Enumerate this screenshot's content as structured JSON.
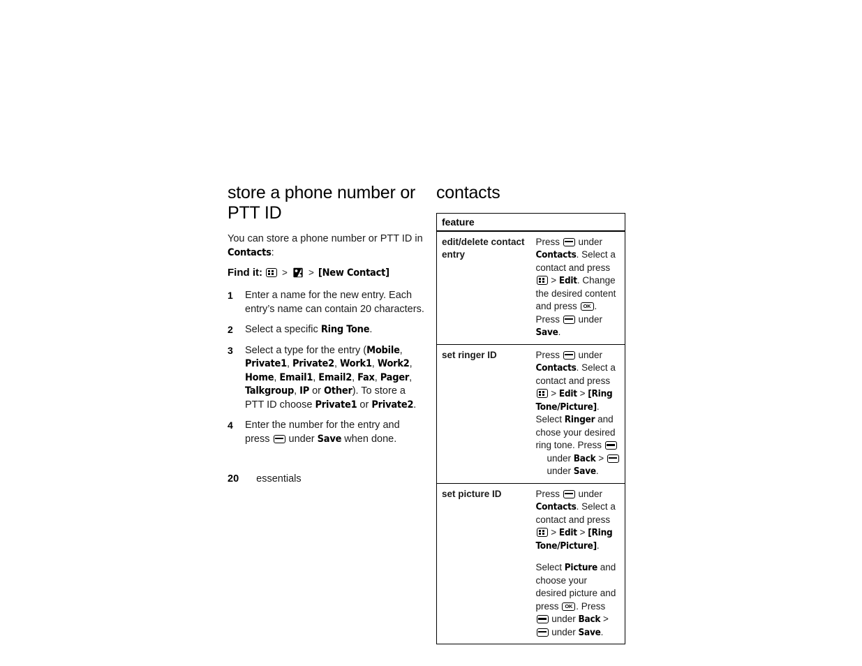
{
  "page": {
    "number": "20",
    "chapter": "essentials"
  },
  "left_column": {
    "heading": "store a phone number or PTT ID",
    "intro": {
      "text_before": "You can store a phone number or PTT ID in ",
      "ui_term": "Contacts",
      "text_after": ":"
    },
    "find_it": {
      "label": "Find it:",
      "icons": [
        "menu-key-icon",
        "contacts-book-icon"
      ],
      "separator": ">",
      "destination": "[New Contact]"
    },
    "steps": [
      {
        "number": "1",
        "parts": [
          {
            "type": "plain",
            "text": "Enter a name for the new entry. Each entry’s name can contain 20 characters."
          }
        ]
      },
      {
        "number": "2",
        "parts": [
          {
            "type": "plain",
            "text": "Select a specific "
          },
          {
            "type": "ui",
            "text": "Ring Tone"
          },
          {
            "type": "plain",
            "text": "."
          }
        ]
      },
      {
        "number": "3",
        "parts": [
          {
            "type": "plain",
            "text": "Select a type for the entry ("
          },
          {
            "type": "ui",
            "text": "Mobile"
          },
          {
            "type": "plain",
            "text": ", "
          },
          {
            "type": "ui",
            "text": "Private1"
          },
          {
            "type": "plain",
            "text": ", "
          },
          {
            "type": "ui",
            "text": "Private2"
          },
          {
            "type": "plain",
            "text": ", "
          },
          {
            "type": "ui",
            "text": "Work1"
          },
          {
            "type": "plain",
            "text": ", "
          },
          {
            "type": "ui",
            "text": "Work2"
          },
          {
            "type": "plain",
            "text": ", "
          },
          {
            "type": "ui",
            "text": "Home"
          },
          {
            "type": "plain",
            "text": ", "
          },
          {
            "type": "ui",
            "text": "Email1"
          },
          {
            "type": "plain",
            "text": ", "
          },
          {
            "type": "ui",
            "text": "Email2"
          },
          {
            "type": "plain",
            "text": ", "
          },
          {
            "type": "ui",
            "text": "Fax"
          },
          {
            "type": "plain",
            "text": ", "
          },
          {
            "type": "ui",
            "text": "Pager"
          },
          {
            "type": "plain",
            "text": ", "
          },
          {
            "type": "ui",
            "text": "Talkgroup"
          },
          {
            "type": "plain",
            "text": ", "
          },
          {
            "type": "ui",
            "text": "IP"
          },
          {
            "type": "plain",
            "text": " or "
          },
          {
            "type": "ui",
            "text": "Other"
          },
          {
            "type": "plain",
            "text": "). To store a PTT ID choose "
          },
          {
            "type": "ui",
            "text": "Private1"
          },
          {
            "type": "plain",
            "text": " or "
          },
          {
            "type": "ui",
            "text": "Private2"
          },
          {
            "type": "plain",
            "text": "."
          }
        ]
      },
      {
        "number": "4",
        "parts": [
          {
            "type": "plain",
            "text": "Enter the number for the entry and press "
          },
          {
            "type": "icon",
            "text": "soft-key-icon"
          },
          {
            "type": "plain",
            "text": " under "
          },
          {
            "type": "ui",
            "text": "Save"
          },
          {
            "type": "plain",
            "text": " when done."
          }
        ]
      }
    ]
  },
  "right_column": {
    "heading": "contacts",
    "table": {
      "header": "feature",
      "rows": [
        {
          "feature": "edit/delete contact entry",
          "description_parts": [
            {
              "type": "plain",
              "text": "Press "
            },
            {
              "type": "icon",
              "text": "soft-key-icon"
            },
            {
              "type": "plain",
              "text": " under "
            },
            {
              "type": "ui",
              "text": "Contacts"
            },
            {
              "type": "plain",
              "text": ". Select a contact and press "
            },
            {
              "type": "icon",
              "text": "menu-key-icon"
            },
            {
              "type": "plain",
              "text": " > "
            },
            {
              "type": "ui",
              "text": "Edit"
            },
            {
              "type": "plain",
              "text": ". Change the desired content and press "
            },
            {
              "type": "icon",
              "text": "ok-key-icon"
            },
            {
              "type": "plain",
              "text": ". Press "
            },
            {
              "type": "icon",
              "text": "soft-key-icon"
            },
            {
              "type": "plain",
              "text": " under "
            },
            {
              "type": "ui",
              "text": "Save"
            },
            {
              "type": "plain",
              "text": "."
            }
          ]
        },
        {
          "feature": "set ringer ID",
          "description_parts": [
            {
              "type": "plain",
              "text": "Press "
            },
            {
              "type": "icon",
              "text": "soft-key-icon"
            },
            {
              "type": "plain",
              "text": " under "
            },
            {
              "type": "ui",
              "text": "Contacts"
            },
            {
              "type": "plain",
              "text": ". Select a contact and press "
            },
            {
              "type": "icon",
              "text": "menu-key-icon"
            },
            {
              "type": "plain",
              "text": " > "
            },
            {
              "type": "ui",
              "text": "Edit"
            },
            {
              "type": "plain",
              "text": " > "
            },
            {
              "type": "ui",
              "text": "[Ring Tone/Picture]"
            },
            {
              "type": "plain",
              "text": ". Select "
            },
            {
              "type": "ui",
              "text": "Ringer"
            },
            {
              "type": "plain",
              "text": " and chose your desired ring tone. Press "
            },
            {
              "type": "icon",
              "text": "soft-key-icon"
            },
            {
              "type": "plain",
              "text": " under "
            },
            {
              "type": "ui",
              "text": "Back"
            },
            {
              "type": "plain",
              "text": " > "
            },
            {
              "type": "icon",
              "text": "soft-key-icon"
            },
            {
              "type": "plain",
              "text": " under "
            },
            {
              "type": "ui",
              "text": "Save"
            },
            {
              "type": "plain",
              "text": "."
            }
          ]
        },
        {
          "feature": "set picture ID",
          "description_parts": [
            {
              "type": "plain",
              "text": "Press "
            },
            {
              "type": "icon",
              "text": "soft-key-icon"
            },
            {
              "type": "plain",
              "text": " under "
            },
            {
              "type": "ui",
              "text": "Contacts"
            },
            {
              "type": "plain",
              "text": ". Select a contact and press "
            },
            {
              "type": "icon",
              "text": "menu-key-icon"
            },
            {
              "type": "plain",
              "text": " > "
            },
            {
              "type": "ui",
              "text": "Edit"
            },
            {
              "type": "plain",
              "text": " > "
            },
            {
              "type": "ui",
              "text": "[Ring Tone/Picture]"
            },
            {
              "type": "plain",
              "text": "."
            }
          ],
          "description_parts_2": [
            {
              "type": "plain",
              "text": "Select "
            },
            {
              "type": "ui",
              "text": "Picture"
            },
            {
              "type": "plain",
              "text": " and choose your desired picture and press "
            },
            {
              "type": "icon",
              "text": "ok-key-icon"
            },
            {
              "type": "plain",
              "text": ". Press "
            },
            {
              "type": "icon",
              "text": "soft-key-icon"
            },
            {
              "type": "plain",
              "text": " under "
            },
            {
              "type": "ui",
              "text": "Back"
            },
            {
              "type": "plain",
              "text": " > "
            },
            {
              "type": "icon",
              "text": "soft-key-icon"
            },
            {
              "type": "plain",
              "text": " under "
            },
            {
              "type": "ui",
              "text": "Save"
            },
            {
              "type": "plain",
              "text": "."
            }
          ]
        }
      ]
    }
  },
  "colors": {
    "text": "#000000",
    "body_text": "#1a1a1a",
    "background": "#ffffff",
    "rule": "#000000"
  }
}
